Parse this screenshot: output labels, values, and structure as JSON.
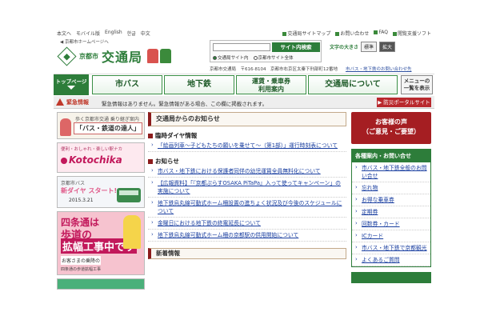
{
  "util": {
    "left": [
      "本文へ",
      "モバイル版",
      "English",
      "한글",
      "中文"
    ],
    "right": [
      "交通局サイトマップ",
      "お問い合わせ",
      "FAQ",
      "閲覧支援ソフト"
    ]
  },
  "header": {
    "top_link": "京都市ホームページへ",
    "city": "京都市",
    "bureau": "交通局",
    "search_placeholder": "",
    "search_button": "サイト内検索",
    "radio_site": "交通局サイト内",
    "radio_all": "京都市サイト全体",
    "font_label": "文字の大きさ",
    "font_std": "標準",
    "font_big": "拡大",
    "address": "京都市交通局　〒616-8104　京都市右京区太秦下刑部町12番地",
    "contact_link": "市バス・地下鉄のお問い合わせ先"
  },
  "nav": {
    "home": "トップページ",
    "tabs": [
      "市バス",
      "地下鉄",
      "運賃・乗車券\n利用案内",
      "交通局について"
    ],
    "menu": "メニューの\n一覧を表示"
  },
  "emergency": {
    "title": "緊急情報",
    "message": "緊急情報はありません。緊急情報がある場合、この欄に掲載されます。",
    "portal": "防災ポータルサイト"
  },
  "banners": {
    "b1_small": "歩く京都市交通 乗り継ぎ案内",
    "b1_title": "「バス・鉄道の達人」",
    "b2_small": "便利・おしゃれ・楽しい駅ナカ",
    "b2_title": "Kotochika",
    "b3_small": "京都市バス",
    "b3_title": "新ダイヤ スタート!",
    "b3_date": "2015.3.21",
    "b4_l1": "四条通は",
    "b4_l2": "歩道の",
    "b4_l3": "拡幅工事中です",
    "b4_l4": "お客さまの乗降の",
    "b4_l5": "四条通の歩道拡幅工事"
  },
  "main": {
    "title": "交通局からのお知らせ",
    "sections": [
      {
        "title": "臨時ダイヤ情報",
        "links": [
          "「絵画列車〜子どもたちの願いを乗せて〜（第1部）」運行時刻表について"
        ]
      },
      {
        "title": "お知らせ",
        "links": [
          "市バス・地下鉄における保護者同伴の幼児運賃全員無料化について",
          "【広報資料】「『京都ぷらすOSAKA PiTaPa』入って使ってキャンペーン」の実施について",
          "地下鉄烏丸線可動式ホーム柵設置の進ちょく状況及び今後のスケジュールについて",
          "金曜日における地下鉄の終電延長について",
          "地下鉄烏丸線可動式ホーム柵の京都駅の供用開始について"
        ]
      }
    ],
    "new_info": "新着情報"
  },
  "side": {
    "voice": "お客様の声\n（ご意見・ご要望）",
    "box_title": "各種案内・お問い合せ",
    "items": [
      "市バス・地下鉄全般のお問い合せ",
      "忘れ物",
      "お得な乗車券",
      "定期券",
      "回数券・カード",
      "ICカード",
      "市バス・地下鉄で京都観光",
      "よくあるご質問"
    ]
  },
  "colors": {
    "brand_green": "#2d7d3a",
    "alert_red": "#c0392b",
    "voice_red": "#a51e22",
    "link_blue": "#1a3fa0"
  }
}
